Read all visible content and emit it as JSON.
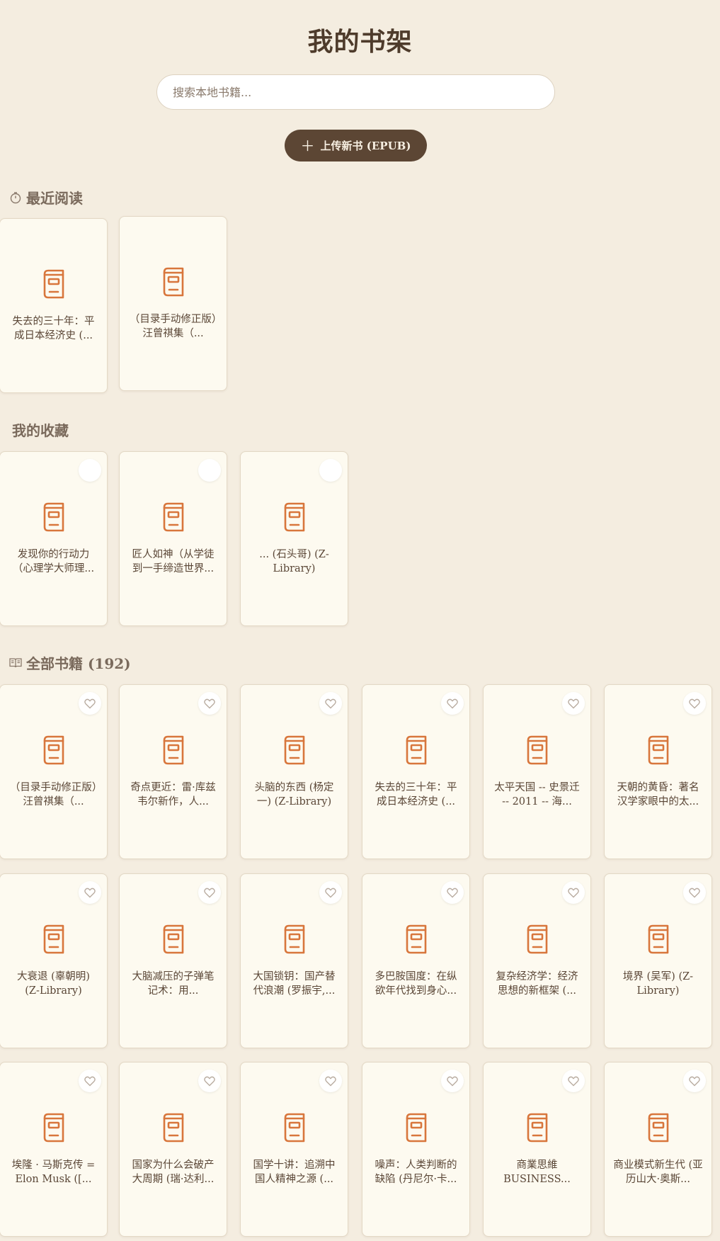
{
  "page": {
    "title": "我的书架"
  },
  "search": {
    "placeholder": "搜索本地书籍..."
  },
  "upload": {
    "label": "上传新书 (EPUB)"
  },
  "colors": {
    "accent": "#d8763c",
    "button_bg": "#5c4634",
    "background": "#f4ede0"
  },
  "recent": {
    "title": "最近阅读",
    "icon": "timer-icon",
    "books": [
      {
        "title": "失去的三十年：平成日本经济史 (..."
      },
      {
        "title": "（目录手动修正版）汪曾祺集（..."
      }
    ]
  },
  "favorites": {
    "title": "我的收藏",
    "books": [
      {
        "title": "发现你的行动力（心理学大师理..."
      },
      {
        "title": "匠人如神（从学徒到一手缔造世界..."
      },
      {
        "title": "... (石头哥) (Z-Library)"
      }
    ]
  },
  "all": {
    "title": "全部书籍 (192)",
    "icon": "book-open-icon",
    "books": [
      {
        "title": "（目录手动修正版）汪曾祺集（..."
      },
      {
        "title": "奇点更近：雷·库兹韦尔新作，人..."
      },
      {
        "title": "头脑的东西 (杨定一) (Z-Library)"
      },
      {
        "title": "失去的三十年：平成日本经济史 (..."
      },
      {
        "title": "太平天国 -- 史景迁 -- 2011 -- 海..."
      },
      {
        "title": "天朝的黄昏：著名汉学家眼中的太..."
      },
      {
        "title": "大衰退 (辜朝明) (Z-Library)"
      },
      {
        "title": "大脑减压的子弹笔记术：用..."
      },
      {
        "title": "大国锁钥：国产替代浪潮 (罗振宇,..."
      },
      {
        "title": "多巴胺国度：在纵欲年代找到身心..."
      },
      {
        "title": "复杂经济学：经济思想的新框架 (..."
      },
      {
        "title": "境界 (吴军) (Z-Library)"
      },
      {
        "title": "埃隆 · 马斯克传 = Elon Musk ([..."
      },
      {
        "title": "国家为什么会破产 大周期 (瑞·达利..."
      },
      {
        "title": "国学十讲：追溯中国人精神之源 (..."
      },
      {
        "title": "噪声：人类判断的缺陷 (丹尼尔·卡..."
      },
      {
        "title": "商業思維 BUSINESS..."
      },
      {
        "title": "商业模式新生代 (亚历山大·奥斯..."
      }
    ]
  }
}
